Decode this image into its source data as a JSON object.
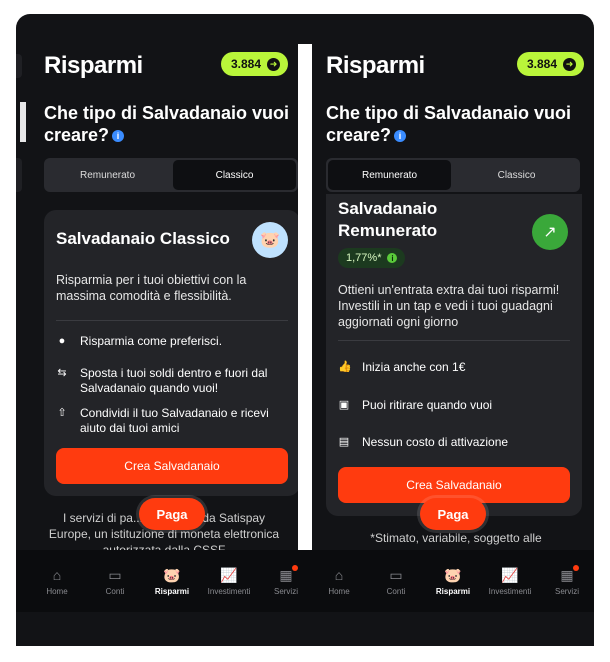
{
  "header": {
    "title": "Risparmi",
    "points": "3.884"
  },
  "question": "Che tipo di Salvadanaio vuoi creare?",
  "segment": {
    "option1": "Remunerato",
    "option2": "Classico"
  },
  "left_card": {
    "title": "Salvadanaio Classico",
    "description": "Risparmia per i tuoi obiettivi con la massima comodità e flessibilità.",
    "features": [
      "Risparmia come preferisci.",
      "Sposta i tuoi soldi dentro e fuori dal Salvadanaio quando vuoi!",
      "Condividi il tuo Salvadanaio e ricevi aiuto dai tuoi amici"
    ],
    "cta": "Crea Salvadanaio"
  },
  "left_footer": "I servizi di pa... ono forniti da Satispay Europe, un istituzione di moneta elettronica autorizzata dalla CSSF",
  "right_card": {
    "title": "Salvadanaio Remunerato",
    "rate": "1,77%*",
    "description": "Ottieni un'entrata extra dai tuoi risparmi! Investili in un tap e vedi i tuoi guadagni aggiornati ogni giorno",
    "features": [
      "Inizia anche con 1€",
      "Puoi ritirare quando vuoi",
      "Nessun costo di attivazione"
    ],
    "cta": "Crea Salvadanaio"
  },
  "right_footer": "*Stimato, variabile, soggetto alle",
  "paga_label": "Paga",
  "tabs": [
    "Home",
    "Conti",
    "Risparmi",
    "Investimenti",
    "Servizi"
  ],
  "colors": {
    "accent": "#ff3b0f",
    "points_bg": "#b9f53a",
    "background": "#121316"
  }
}
